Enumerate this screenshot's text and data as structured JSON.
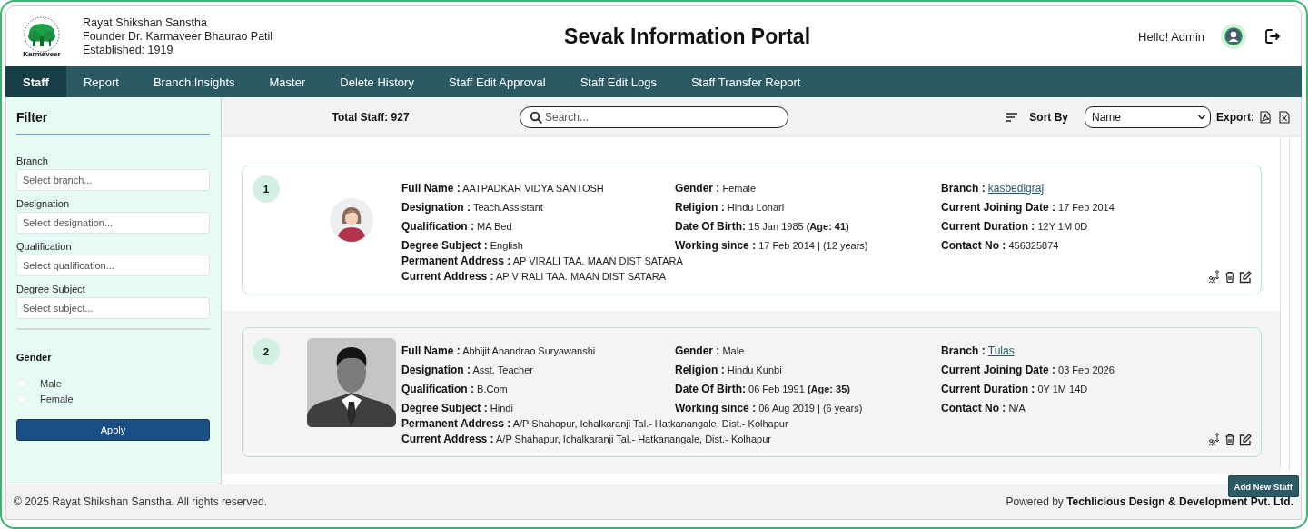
{
  "org": {
    "name": "Rayat Shikshan Sanstha",
    "founder": "Founder Dr. Karmaveer Bhaurao Patil",
    "established": "Established: 1919",
    "logo_caption": "Karmaveer"
  },
  "title": "Sevak Information Portal",
  "user": {
    "greeting": "Hello! Admin"
  },
  "tabs": [
    {
      "label": "Staff",
      "selected": true
    },
    {
      "label": "Report",
      "selected": false
    },
    {
      "label": "Branch Insights",
      "selected": false
    },
    {
      "label": "Master",
      "selected": false
    },
    {
      "label": "Delete History",
      "selected": false
    },
    {
      "label": "Staff Edit Approval",
      "selected": false
    },
    {
      "label": "Staff Edit Logs",
      "selected": false
    },
    {
      "label": "Staff Transfer Report",
      "selected": false
    }
  ],
  "filter": {
    "title": "Filter",
    "fields": [
      {
        "label": "Branch",
        "placeholder": "Select branch..."
      },
      {
        "label": "Designation",
        "placeholder": "Select designation..."
      },
      {
        "label": "Qualification",
        "placeholder": "Select qualification..."
      },
      {
        "label": "Degree Subject",
        "placeholder": "Select subject..."
      }
    ],
    "gender": {
      "label": "Gender",
      "options": [
        {
          "label": "Male",
          "checked": false
        },
        {
          "label": "Female",
          "checked": false
        }
      ]
    },
    "apply": "Apply"
  },
  "toolbar": {
    "total": "Total Staff: 927",
    "search_placeholder": "Search...",
    "sort_label": "Sort By",
    "sort_value": "Name",
    "export_label": "Export:"
  },
  "staff": [
    {
      "number": "1",
      "kind": "female",
      "columns": [
        [
          {
            "label": "Full Name :",
            "value": "AATPADKAR VIDYA SANTOSH"
          },
          {
            "label": "Designation :",
            "value": "Teach.Assistant"
          },
          {
            "label": "Qualification :",
            "value": "MA Bed"
          },
          {
            "label": "Degree Subject :",
            "value": "English"
          }
        ],
        [
          {
            "label": "Gender :",
            "value": "Female"
          },
          {
            "label": "Religion :",
            "value": "Hindu Lonari"
          },
          {
            "label": "Date Of Birth:",
            "value": "15 Jan 1985 **(Age: 41)**"
          },
          {
            "label": "Working since :",
            "value": "17 Feb 2014 | (12 years)"
          }
        ],
        [
          {
            "label": "Branch :",
            "value": "kasbedigraj",
            "kind": "link"
          },
          {
            "label": "Current Joining Date :",
            "value": "17 Feb 2014"
          },
          {
            "label": "Current Duration :",
            "value": "12Y 1M 0D"
          },
          {
            "label": "Contact No :",
            "value": "456325874"
          }
        ]
      ],
      "addresses": [
        {
          "label": "Permanent Address :",
          "value": "AP VIRALI TAA. MAAN DIST SATARA"
        },
        {
          "label": "Current Address :",
          "value": "AP VIRALI TAA. MAAN DIST SATARA"
        }
      ]
    },
    {
      "number": "2",
      "kind": "male",
      "columns": [
        [
          {
            "label": "Full Name :",
            "value": "Abhijit Anandrao Suryawanshi"
          },
          {
            "label": "Designation :",
            "value": "Asst. Teacher"
          },
          {
            "label": "Qualification :",
            "value": "B.Com"
          },
          {
            "label": "Degree Subject :",
            "value": "Hindi"
          }
        ],
        [
          {
            "label": "Gender :",
            "value": "Male"
          },
          {
            "label": "Religion :",
            "value": "Hindu Kunbi"
          },
          {
            "label": "Date Of Birth:",
            "value": "06 Feb 1991 **(Age: 35)**"
          },
          {
            "label": "Working since :",
            "value": "06 Aug 2019 | (6 years)"
          }
        ],
        [
          {
            "label": "Branch :",
            "value": "Tulas",
            "kind": "link"
          },
          {
            "label": "Current Joining Date :",
            "value": "03 Feb 2026"
          },
          {
            "label": "Current Duration :",
            "value": "0Y 1M 14D"
          },
          {
            "label": "Contact No :",
            "value": "N/A"
          }
        ]
      ],
      "addresses": [
        {
          "label": "Permanent Address :",
          "value": "A/P Shahapur, Ichalkaranji Tal.- Hatkanangale, Dist.- Kolhapur"
        },
        {
          "label": "Current Address :",
          "value": "A/P Shahapur, Ichalkaranji Tal.- Hatkanangale, Dist.- Kolhapur"
        }
      ]
    }
  ],
  "add_button": "Add New Staff",
  "footer": {
    "copyright": "© 2025 Rayat Shikshan Sanstha. All rights reserved.",
    "powered": "Powered by **Techlicious Design & Development Pvt. Ltd.**"
  }
}
